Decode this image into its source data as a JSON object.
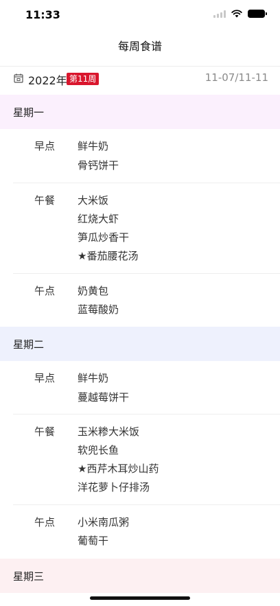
{
  "status": {
    "time": "11:33"
  },
  "nav": {
    "title": "每周食谱"
  },
  "week": {
    "year": "2022年",
    "badge": "第11周",
    "range": "11-07/11-11"
  },
  "days": [
    {
      "title": "星期一",
      "bg": "#fbf0fd",
      "meals": [
        {
          "label": "早点",
          "dishes": [
            "鲜牛奶",
            "骨钙饼干"
          ]
        },
        {
          "label": "午餐",
          "dishes": [
            "大米饭",
            "红烧大虾",
            "笋瓜炒香干",
            "★番茄腰花汤"
          ]
        },
        {
          "label": "午点",
          "dishes": [
            "奶黄包",
            "蓝莓酸奶"
          ]
        }
      ]
    },
    {
      "title": "星期二",
      "bg": "#eef1fd",
      "meals": [
        {
          "label": "早点",
          "dishes": [
            "鲜牛奶",
            "蔓越莓饼干"
          ]
        },
        {
          "label": "午餐",
          "dishes": [
            "玉米糁大米饭",
            "软兜长鱼",
            "★西芹木耳炒山药",
            "洋花萝卜仔排汤"
          ]
        },
        {
          "label": "午点",
          "dishes": [
            "小米南瓜粥",
            "葡萄干"
          ]
        }
      ]
    },
    {
      "title": "星期三",
      "bg": "#fdf0f2",
      "meals": []
    }
  ]
}
